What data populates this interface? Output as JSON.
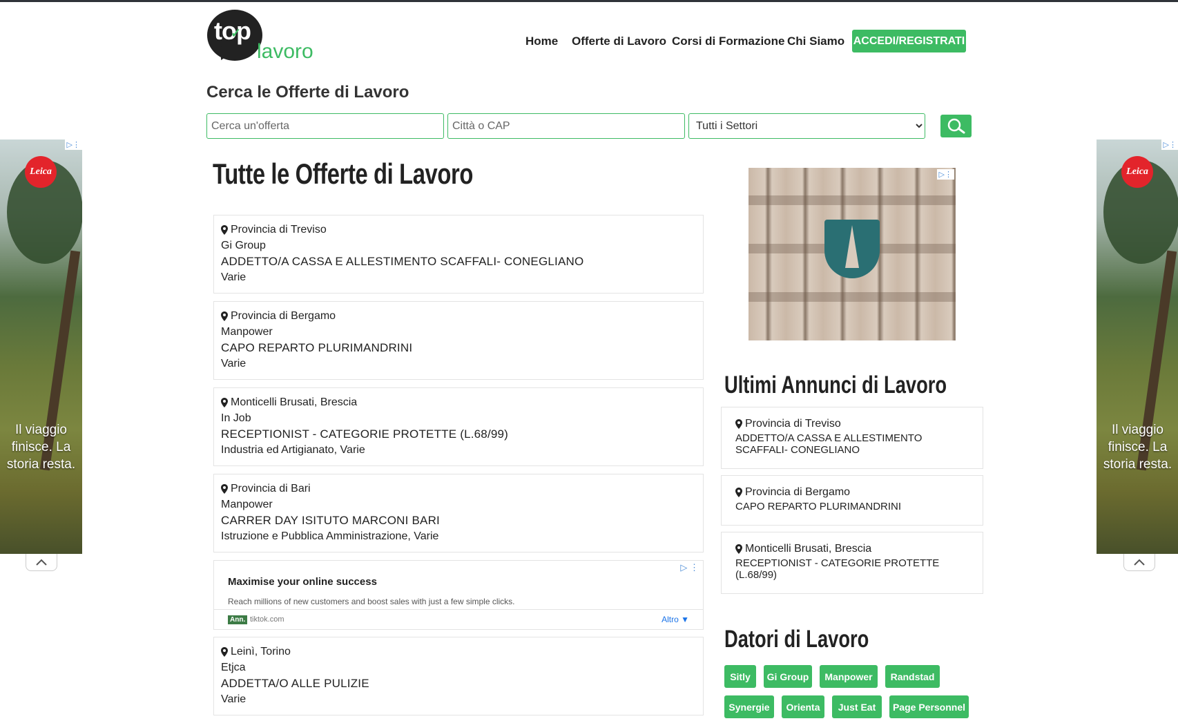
{
  "header": {
    "logo_top": "top",
    "logo_bottom": "lavoro",
    "nav": [
      "Home",
      "Offerte di Lavoro",
      "Corsi di Formazione",
      "Chi Siamo"
    ],
    "cta": "ACCEDI/REGISTRATI"
  },
  "search": {
    "title": "Cerca le Offerte di Lavoro",
    "offer_placeholder": "Cerca un'offerta",
    "city_placeholder": "Città o CAP",
    "sector_selected": "Tutti i Settori"
  },
  "main": {
    "title": "Tutte le Offerte di Lavoro",
    "jobs": [
      {
        "location": "Provincia di Treviso",
        "company": "Gi Group",
        "title": "ADDETTO/A CASSA E ALLESTIMENTO SCAFFALI- CONEGLIANO",
        "category": "Varie"
      },
      {
        "location": "Provincia di Bergamo",
        "company": "Manpower",
        "title": "CAPO REPARTO PLURIMANDRINI",
        "category": "Varie"
      },
      {
        "location": "Monticelli Brusati, Brescia",
        "company": "In Job",
        "title": "RECEPTIONIST - CATEGORIE PROTETTE (L.68/99)",
        "category": "Industria ed Artigianato, Varie"
      },
      {
        "location": "Provincia di Bari",
        "company": "Manpower",
        "title": "CARRER DAY ISITUTO MARCONI BARI",
        "category": "Istruzione e Pubblica Amministrazione, Varie"
      },
      {
        "location": "Leinì, Torino",
        "company": "Etjca",
        "title": "ADDETTA/O ALLE PULIZIE",
        "category": "Varie"
      }
    ]
  },
  "inline_ad": {
    "headline": "Maximise your online success",
    "text": "Reach millions of new customers and boost sales with just a few simple clicks.",
    "badge": "Ann.",
    "domain": "tiktok.com",
    "more": "Altro"
  },
  "side_ad": {
    "brand": "Leica",
    "text": "Il viaggio finisce. La storia resta."
  },
  "sidebar": {
    "latest_title": "Ultimi Annunci di Lavoro",
    "latest": [
      {
        "location": "Provincia di Treviso",
        "title": "ADDETTO/A CASSA E ALLESTIMENTO SCAFFALI- CONEGLIANO"
      },
      {
        "location": "Provincia di Bergamo",
        "title": "CAPO REPARTO PLURIMANDRINI"
      },
      {
        "location": "Monticelli Brusati, Brescia",
        "title": "RECEPTIONIST - CATEGORIE PROTETTE (L.68/99)"
      }
    ],
    "employers_title": "Datori di Lavoro",
    "employers": [
      "Sitly",
      "Gi Group",
      "Manpower",
      "Randstad",
      "Synergie",
      "Orienta",
      "Just Eat",
      "Page Personnel"
    ]
  },
  "icons": {
    "search": "search-icon",
    "pin": "map-pin-icon",
    "ad_choices": "ad-choices-icon",
    "collapse": "chevron-up-icon"
  },
  "colors": {
    "accent": "#3dbb63",
    "text": "#222222",
    "border": "#e3e3e3"
  }
}
